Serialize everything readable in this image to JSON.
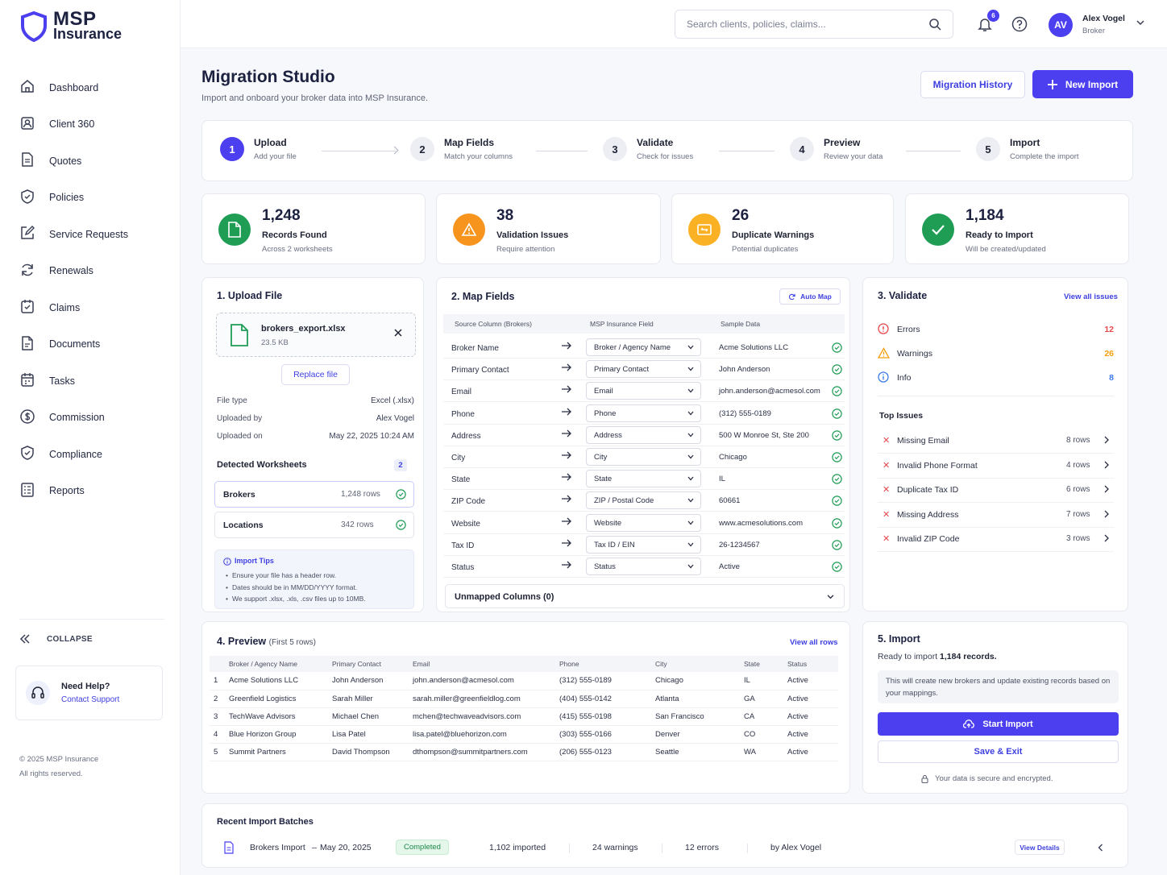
{
  "brand": {
    "line1": "MSP",
    "line2": "Insurance"
  },
  "colors": {
    "primary": "#4b3ff0",
    "success": "#1f9d55",
    "warning": "#f59e0b",
    "error": "#e5484d",
    "info": "#3b7be8"
  },
  "sidebar": {
    "items": [
      {
        "label": "Dashboard",
        "icon": "home-icon"
      },
      {
        "label": "Client 360",
        "icon": "client-icon"
      },
      {
        "label": "Quotes",
        "icon": "document-icon"
      },
      {
        "label": "Policies",
        "icon": "shield-icon"
      },
      {
        "label": "Service Requests",
        "icon": "edit-icon"
      },
      {
        "label": "Renewals",
        "icon": "refresh-icon"
      },
      {
        "label": "Claims",
        "icon": "claims-icon"
      },
      {
        "label": "Documents",
        "icon": "file-icon"
      },
      {
        "label": "Tasks",
        "icon": "calendar-icon"
      },
      {
        "label": "Commission",
        "icon": "dollar-icon"
      },
      {
        "label": "Compliance",
        "icon": "shield-check-icon"
      },
      {
        "label": "Reports",
        "icon": "report-icon"
      }
    ],
    "collapse": "COLLAPSE",
    "help_title": "Need Help?",
    "help_link": "Contact Support",
    "copyright": "© 2025 MSP Insurance",
    "rights": "All rights reserved."
  },
  "topbar": {
    "search_placeholder": "Search clients, policies, claims...",
    "notifications": "6",
    "avatar": "AV",
    "user_name": "Alex Vogel",
    "user_role": "Broker"
  },
  "page": {
    "title": "Migration Studio",
    "subtitle": "Import and onboard your broker data into MSP Insurance.",
    "history_btn": "Migration History",
    "new_import_btn": "New Import"
  },
  "steps": [
    {
      "num": "1",
      "title": "Upload",
      "sub": "Add your file"
    },
    {
      "num": "2",
      "title": "Map Fields",
      "sub": "Match your columns"
    },
    {
      "num": "3",
      "title": "Validate",
      "sub": "Check for issues"
    },
    {
      "num": "4",
      "title": "Preview",
      "sub": "Review your data"
    },
    {
      "num": "5",
      "title": "Import",
      "sub": "Complete the import"
    }
  ],
  "stats": [
    {
      "value": "1,248",
      "label": "Records Found",
      "sub": "Across 2 worksheets",
      "color": "#1f9d55"
    },
    {
      "value": "38",
      "label": "Validation Issues",
      "sub": "Require attention",
      "color": "#f7941d"
    },
    {
      "value": "26",
      "label": "Duplicate Warnings",
      "sub": "Potential duplicates",
      "color": "#fbb124"
    },
    {
      "value": "1,184",
      "label": "Ready to Import",
      "sub": "Will be created/updated",
      "color": "#1f9d55"
    }
  ],
  "upload": {
    "title": "1. Upload File",
    "file_name": "brokers_export.xlsx",
    "file_size": "23.5 KB",
    "replace_btn": "Replace file",
    "meta": [
      {
        "k": "File type",
        "v": "Excel (.xlsx)"
      },
      {
        "k": "Uploaded by",
        "v": "Alex Vogel"
      },
      {
        "k": "Uploaded on",
        "v": "May 22, 2025 10:24 AM"
      }
    ],
    "detected_title": "Detected Worksheets",
    "detected_count": "2",
    "worksheets": [
      {
        "name": "Brokers",
        "rows": "1,248 rows"
      },
      {
        "name": "Locations",
        "rows": "342 rows"
      }
    ],
    "tips_title": "Import Tips",
    "tips": [
      "Ensure your file has a header row.",
      "Dates should be in MM/DD/YYYY format.",
      "We support .xlsx, .xls, .csv files up to 10MB."
    ]
  },
  "map": {
    "title": "2. Map Fields",
    "automap": "Auto Map",
    "headers": {
      "source": "Source Column",
      "source_note": "(Brokers)",
      "field": "MSP Insurance Field",
      "sample": "Sample Data"
    },
    "rows": [
      {
        "src": "Broker Name",
        "field": "Broker / Agency Name",
        "sample": "Acme Solutions LLC"
      },
      {
        "src": "Primary Contact",
        "field": "Primary Contact",
        "sample": "John Anderson"
      },
      {
        "src": "Email",
        "field": "Email",
        "sample": "john.anderson@acmesol.com"
      },
      {
        "src": "Phone",
        "field": "Phone",
        "sample": "(312) 555-0189"
      },
      {
        "src": "Address",
        "field": "Address",
        "sample": "500 W Monroe St, Ste 200"
      },
      {
        "src": "City",
        "field": "City",
        "sample": "Chicago"
      },
      {
        "src": "State",
        "field": "State",
        "sample": "IL"
      },
      {
        "src": "ZIP Code",
        "field": "ZIP / Postal Code",
        "sample": "60661"
      },
      {
        "src": "Website",
        "field": "Website",
        "sample": "www.acmesolutions.com"
      },
      {
        "src": "Tax ID",
        "field": "Tax ID / EIN",
        "sample": "26-1234567"
      },
      {
        "src": "Status",
        "field": "Status",
        "sample": "Active"
      }
    ],
    "unmapped": "Unmapped Columns (0)"
  },
  "validate": {
    "title": "3. Validate",
    "view_all": "View all issues",
    "summary": [
      {
        "label": "Errors",
        "count": "12",
        "color": "#e5484d"
      },
      {
        "label": "Warnings",
        "count": "26",
        "color": "#f59e0b"
      },
      {
        "label": "Info",
        "count": "8",
        "color": "#3b7be8"
      }
    ],
    "top_title": "Top Issues",
    "issues": [
      {
        "name": "Missing Email",
        "rows": "8 rows"
      },
      {
        "name": "Invalid Phone Format",
        "rows": "4 rows"
      },
      {
        "name": "Duplicate Tax ID",
        "rows": "6 rows"
      },
      {
        "name": "Missing Address",
        "rows": "7 rows"
      },
      {
        "name": "Invalid ZIP Code",
        "rows": "3 rows"
      }
    ]
  },
  "preview": {
    "title": "4. Preview",
    "sub": "(First 5 rows)",
    "view_all": "View all rows",
    "columns": [
      "",
      "Broker / Agency Name",
      "Primary Contact",
      "Email",
      "Phone",
      "City",
      "State",
      "Status"
    ],
    "rows": [
      [
        "1",
        "Acme Solutions LLC",
        "John Anderson",
        "john.anderson@acmesol.com",
        "(312) 555-0189",
        "Chicago",
        "IL",
        "Active"
      ],
      [
        "2",
        "Greenfield Logistics",
        "Sarah Miller",
        "sarah.miller@greenfieldlog.com",
        "(404) 555-0142",
        "Atlanta",
        "GA",
        "Active"
      ],
      [
        "3",
        "TechWave Advisors",
        "Michael Chen",
        "mchen@techwaveadvisors.com",
        "(415) 555-0198",
        "San Francisco",
        "CA",
        "Active"
      ],
      [
        "4",
        "Blue Horizon Group",
        "Lisa Patel",
        "lisa.patel@bluehorizon.com",
        "(303) 555-0166",
        "Denver",
        "CO",
        "Active"
      ],
      [
        "5",
        "Summit Partners",
        "David Thompson",
        "dthompson@summitpartners.com",
        "(206) 555-0123",
        "Seattle",
        "WA",
        "Active"
      ]
    ]
  },
  "import": {
    "title": "5. Import",
    "ready_prefix": "Ready to import",
    "ready_count": "1,184 records.",
    "note": "This will create new brokers and update existing records based on your mappings.",
    "start_btn": "Start Import",
    "save_btn": "Save & Exit",
    "secure": "Your data is secure and encrypted."
  },
  "recent": {
    "title": "Recent Import Batches",
    "batch": {
      "name": "Brokers Import",
      "date": "May 20, 2025",
      "status": "Completed",
      "imported": "1,102 imported",
      "warnings": "24 warnings",
      "errors": "12 errors",
      "by": "by Alex Vogel",
      "details_btn": "View Details"
    }
  }
}
